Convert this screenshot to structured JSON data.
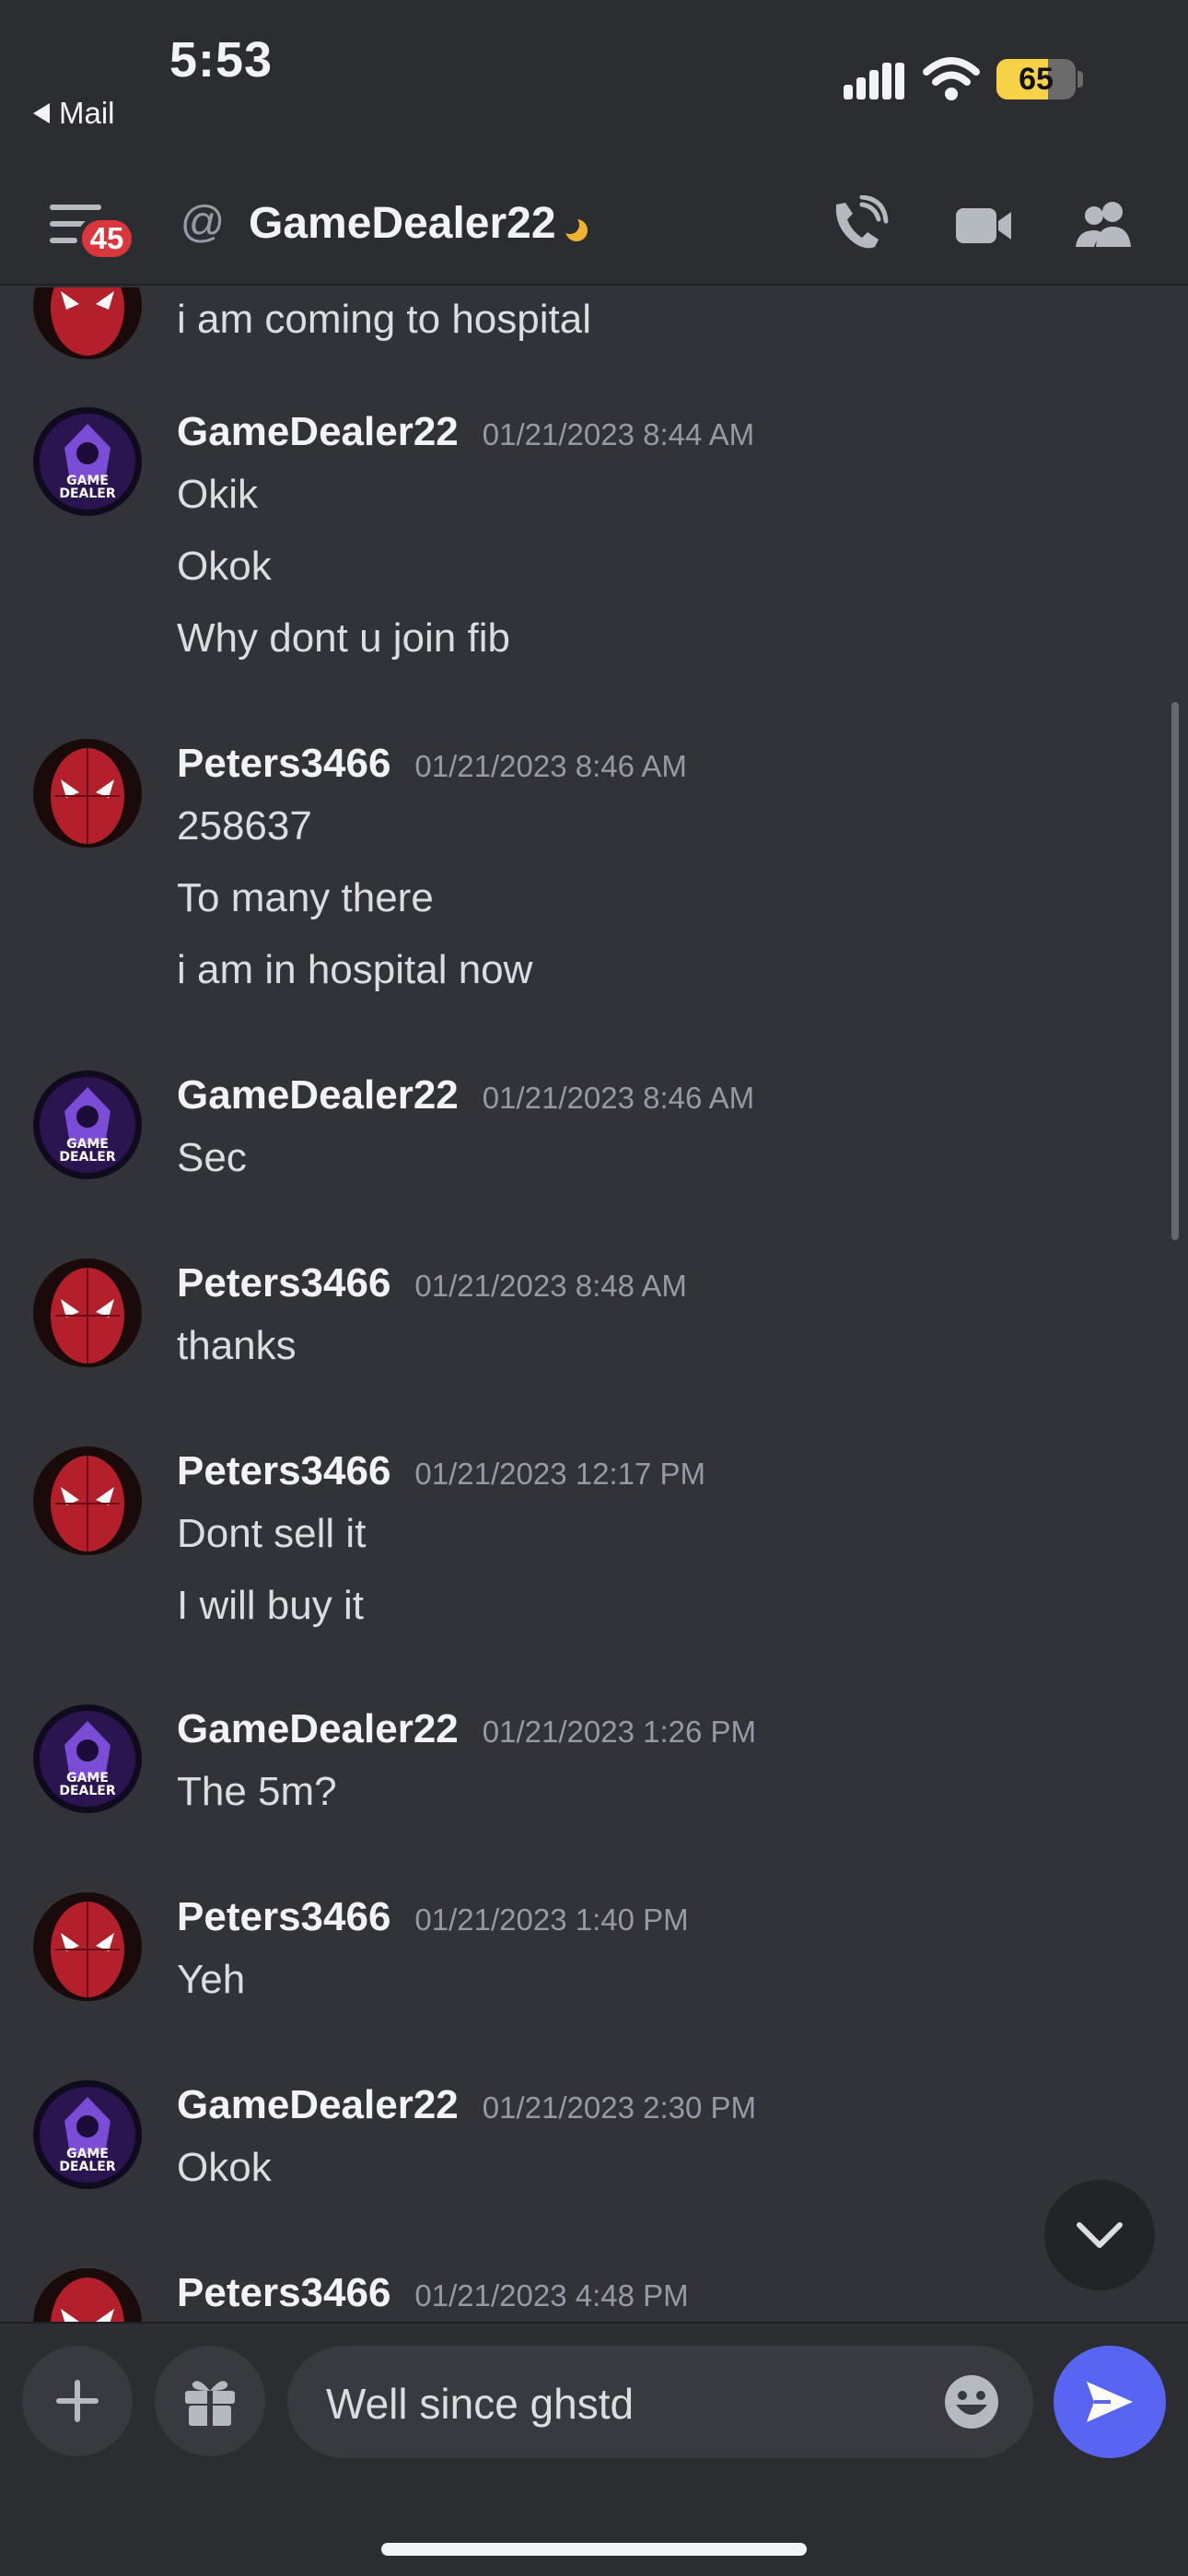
{
  "status_bar": {
    "time": "5:53",
    "back_app": "Mail",
    "battery_level": "65",
    "battery_color": "#f7d246"
  },
  "header": {
    "unread_badge": "45",
    "channel_name": "GameDealer22",
    "status": "idle-moon",
    "icons": [
      "menu-icon",
      "at-icon",
      "phone-call-icon",
      "video-icon",
      "members-icon"
    ]
  },
  "messages": {
    "partial_top": {
      "text": "i am coming to hospital"
    },
    "groups": [
      {
        "author": "GameDealer22",
        "timestamp": "01/21/2023 8:44 AM",
        "lines": [
          "Okik",
          "Okok",
          "Why dont u join fib"
        ]
      },
      {
        "author": "Peters3466",
        "timestamp": "01/21/2023 8:46 AM",
        "lines": [
          "258637",
          "To many there",
          "i am in hospital now"
        ]
      },
      {
        "author": "GameDealer22",
        "timestamp": "01/21/2023 8:46 AM",
        "lines": [
          "Sec"
        ]
      },
      {
        "author": "Peters3466",
        "timestamp": "01/21/2023 8:48 AM",
        "lines": [
          "thanks"
        ]
      },
      {
        "author": "Peters3466",
        "timestamp": "01/21/2023 12:17 PM",
        "lines": [
          "Dont sell it",
          "I will buy it"
        ]
      },
      {
        "author": "GameDealer22",
        "timestamp": "01/21/2023 1:26 PM",
        "lines": [
          "The 5m?"
        ]
      },
      {
        "author": "Peters3466",
        "timestamp": "01/21/2023 1:40 PM",
        "lines": [
          "Yeh"
        ]
      },
      {
        "author": "GameDealer22",
        "timestamp": "01/21/2023 2:30 PM",
        "lines": [
          "Okok"
        ]
      },
      {
        "author": "Peters3466",
        "timestamp": "01/21/2023 4:48 PM",
        "lines": []
      }
    ]
  },
  "composer": {
    "input_value": "Well since ghstd",
    "icons": [
      "plus-icon",
      "gift-icon",
      "emoji-icon",
      "send-icon"
    ],
    "send_color": "#5865f2"
  }
}
